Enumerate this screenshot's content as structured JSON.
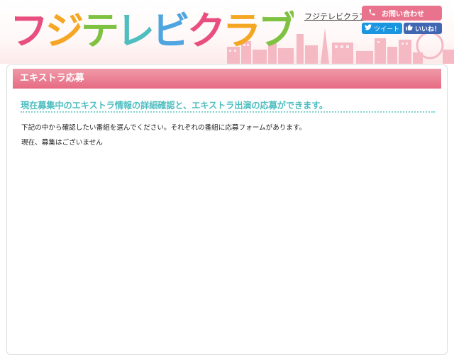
{
  "header": {
    "logo_text": "フジテレビクラブ",
    "brand_link": "フジテレビクラブ",
    "contact_label": "お問い合わせ",
    "tweet_label": "ツイート",
    "like_label": "いいね！"
  },
  "main": {
    "section_title": "エキストラ応募",
    "subtitle": "現在募集中のエキストラ情報の詳細確認と、エキストラ出演の応募ができます。",
    "description": "下記の中から確認したい番組を選んでください。それぞれの番組に応募フォームがあります。",
    "status": "現在、募集はございません"
  },
  "colors": {
    "accent_pink": "#e9728c",
    "accent_teal": "#4fbec0",
    "twitter_blue": "#1b95e0",
    "facebook_blue": "#4267b2"
  }
}
